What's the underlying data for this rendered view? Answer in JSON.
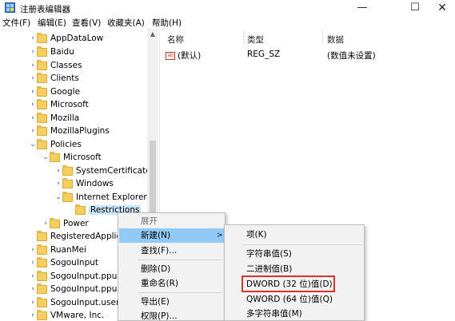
{
  "window": {
    "title": "注册表编辑器"
  },
  "window_controls": {
    "minimize": "—",
    "maximize": "☐",
    "close": "✕"
  },
  "menu": [
    "文件(F)",
    "编辑(E)",
    "查看(V)",
    "收藏夹(A)",
    "帮助(H)"
  ],
  "tree": [
    {
      "label": "AppDataLow"
    },
    {
      "label": "Baidu"
    },
    {
      "label": "Classes"
    },
    {
      "label": "Clients"
    },
    {
      "label": "Google"
    },
    {
      "label": "Microsoft"
    },
    {
      "label": "Mozilla"
    },
    {
      "label": "MozillaPlugins"
    },
    {
      "label": "Policies"
    },
    {
      "label": "Microsoft"
    },
    {
      "label": "SystemCertificates"
    },
    {
      "label": "Windows"
    },
    {
      "label": "Internet Explorer"
    },
    {
      "label": "Restrictions"
    },
    {
      "label": "Power"
    },
    {
      "label": "RegisteredApplic"
    },
    {
      "label": "RuanMei"
    },
    {
      "label": "SogouInput"
    },
    {
      "label": "SogouInput.ppup"
    },
    {
      "label": "SogouInput.ppup"
    },
    {
      "label": "SogouInput.user"
    },
    {
      "label": "VMware, Inc."
    }
  ],
  "list": {
    "columns": [
      "名称",
      "类型",
      "数据"
    ],
    "rows": [
      {
        "name": "(默认)",
        "type": "REG_SZ",
        "data": "(数值未设置)"
      }
    ]
  },
  "context_menu": {
    "items": [
      "展开",
      "新建(N)",
      "查找(F)...",
      "删除(D)",
      "重命名(R)",
      "导出(E)",
      "权限(P)..."
    ],
    "highlighted": "新建(N)"
  },
  "submenu": {
    "items": [
      "项(K)",
      "字符串值(S)",
      "二进制值(B)",
      "DWORD (32 位)值(D)",
      "QWORD (64 位)值(Q)",
      "多字符串值(M)"
    ],
    "emphasized": "DWORD (32 位)值(D)"
  },
  "colors": {
    "highlight": "#91c9f7",
    "emphasis_box": "#e0302a",
    "folder": "#f4cf60"
  }
}
